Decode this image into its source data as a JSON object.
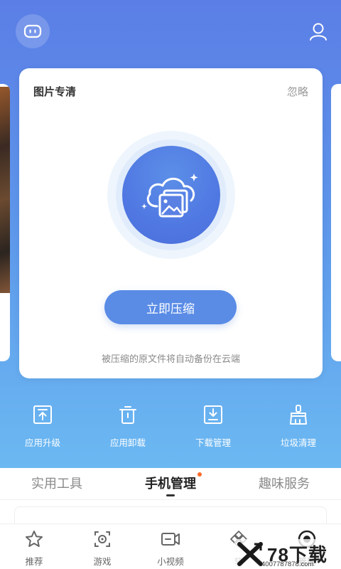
{
  "header": {
    "left_icon": "robot-icon",
    "right_icon": "user-icon"
  },
  "card": {
    "title": "图片专清",
    "dismiss_label": "忽略",
    "hero_icon": "cloud-image-icon",
    "action_label": "立即压缩",
    "note": "被压缩的原文件将自动备份在云端"
  },
  "tools": [
    {
      "label": "应用升级",
      "icon": "upload-box-icon"
    },
    {
      "label": "应用卸载",
      "icon": "trash-icon"
    },
    {
      "label": "下载管理",
      "icon": "download-box-icon"
    },
    {
      "label": "垃圾清理",
      "icon": "brush-icon"
    }
  ],
  "tabs": [
    {
      "label": "实用工具",
      "active": false
    },
    {
      "label": "手机管理",
      "active": true,
      "has_dot": true
    },
    {
      "label": "趣味服务",
      "active": false
    }
  ],
  "bottom_nav": [
    {
      "label": "推荐",
      "icon": "star-icon"
    },
    {
      "label": "游戏",
      "icon": "gamepad-icon"
    },
    {
      "label": "小视频",
      "icon": "video-icon"
    },
    {
      "label": "软",
      "icon": "apps-icon"
    },
    {
      "label": "管理",
      "icon": "target-icon",
      "active": true
    }
  ],
  "watermark": {
    "brand": "78下载",
    "url": "4007787878.com"
  },
  "colors": {
    "gradient_top": "#5b7ee6",
    "gradient_bottom": "#6bb9f2",
    "accent": "#5a8ce6",
    "badge": "#ff6a2a"
  }
}
